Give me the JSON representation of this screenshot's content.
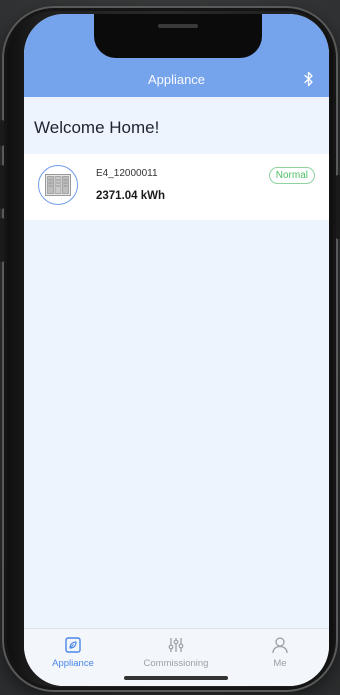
{
  "header": {
    "title": "Appliance",
    "right_icon": "bluetooth-icon"
  },
  "home": {
    "welcome": "Welcome Home!"
  },
  "devices": [
    {
      "name": "E4_12000011",
      "energy": "2371.04 kWh",
      "status": "Normal",
      "icon": "battery-cabinet-icon"
    }
  ],
  "tabbar": {
    "items": [
      {
        "label": "Appliance",
        "icon": "appliance-icon",
        "active": true
      },
      {
        "label": "Commissioning",
        "icon": "sliders-icon",
        "active": false
      },
      {
        "label": "Me",
        "icon": "user-icon",
        "active": false
      }
    ]
  },
  "colors": {
    "header": "#76a4ec",
    "accent": "#4a86e8",
    "status_normal": "#4fbf66",
    "background": "#eef4fd"
  }
}
